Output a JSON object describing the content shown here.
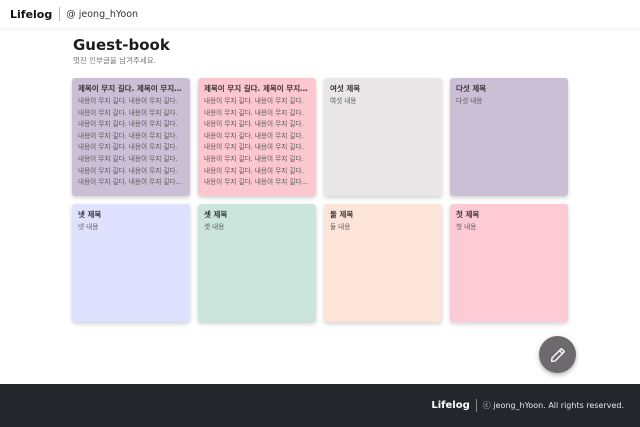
{
  "header": {
    "brand": "Lifelog",
    "user": "@ jeong_hYoon"
  },
  "page": {
    "title": "Guest-book",
    "subtitle": "멋진 인부글을 남겨주세요."
  },
  "cards": [
    {
      "title": "제목이 무지 길다. 제목이 무지 길다.",
      "body": "내용이 무지 길다. 내용이 무지 길다. 내용이 무지 길다. 내용이 무지 길다. 내용이 무지 길다. 내용이 무지 길다. 내용이 무지 길다. 내용이 무지 길다. 내용이 무지 길다. 내용이 무지 길다. 내용이 무지 길다. 내용이 무지 길다. 내용이 무지 길다. 내용이 무지 길다. 내용이 무지 길다. 내용이 무지 길다. 내용이 무지 길다. 내용이 무지 길다.",
      "color": "#cbbfd5"
    },
    {
      "title": "제목이 무지 길다. 제목이 무지 길다.",
      "body": "내용이 무지 길다. 내용이 무지 길다. 내용이 무지 길다. 내용이 무지 길다. 내용이 무지 길다. 내용이 무지 길다. 내용이 무지 길다. 내용이 무지 길다. 내용이 무지 길다. 내용이 무지 길다. 내용이 무지 길다. 내용이 무지 길다. 내용이 무지 길다. 내용이 무지 길다. 내용이 무지 길다. 내용이 무지 길다. 내용이 무지 길다. 내용이 무지 길다.",
      "color": "#fcc7cf"
    },
    {
      "title": "여섯 제목",
      "body": "여섯 내용",
      "color": "#e8e6e6"
    },
    {
      "title": "다섯 제목",
      "body": "다섯 내용",
      "color": "#cbbfd5"
    },
    {
      "title": "넷 제목",
      "body": "넷 내용",
      "color": "#dee2fe"
    },
    {
      "title": "셋 제목",
      "body": "셋 내용",
      "color": "#cbe5dc"
    },
    {
      "title": "둘 제목",
      "body": "둘 내용",
      "color": "#fde4d9"
    },
    {
      "title": "첫 제목",
      "body": "첫 내용",
      "color": "#fdcad6"
    }
  ],
  "fab": {
    "icon": "pencil-icon"
  },
  "footer": {
    "brand": "Lifelog",
    "copyright": "ⓒ jeong_hYoon. All rights reserved."
  }
}
